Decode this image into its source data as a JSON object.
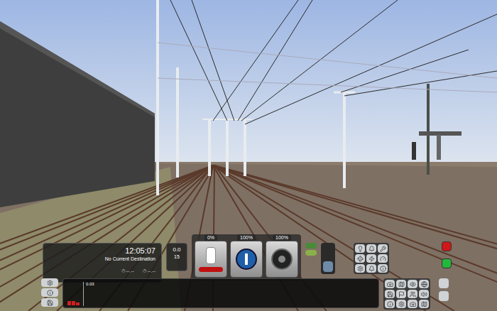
{
  "hud": {
    "time": "12:05:07",
    "destination": "No Current Destination",
    "timers": [
      "--.--",
      "--.--"
    ]
  },
  "speed": {
    "value": "0.0",
    "limit": "15"
  },
  "levers": [
    {
      "name": "reverser",
      "label": "0%",
      "level": 0,
      "kind": "toggle"
    },
    {
      "name": "throttle",
      "label": "100%",
      "level": 1,
      "kind": "blue"
    },
    {
      "name": "brake",
      "label": "100%",
      "level": 1,
      "kind": "dark"
    }
  ],
  "side_slider": {
    "level": 0.4
  },
  "graph": {
    "reading": "0.03",
    "values": [
      0.03,
      0.03,
      0.02
    ]
  },
  "alarm_buttons": [
    {
      "color": "#d01818"
    },
    {
      "color": "#22b83a"
    }
  ]
}
